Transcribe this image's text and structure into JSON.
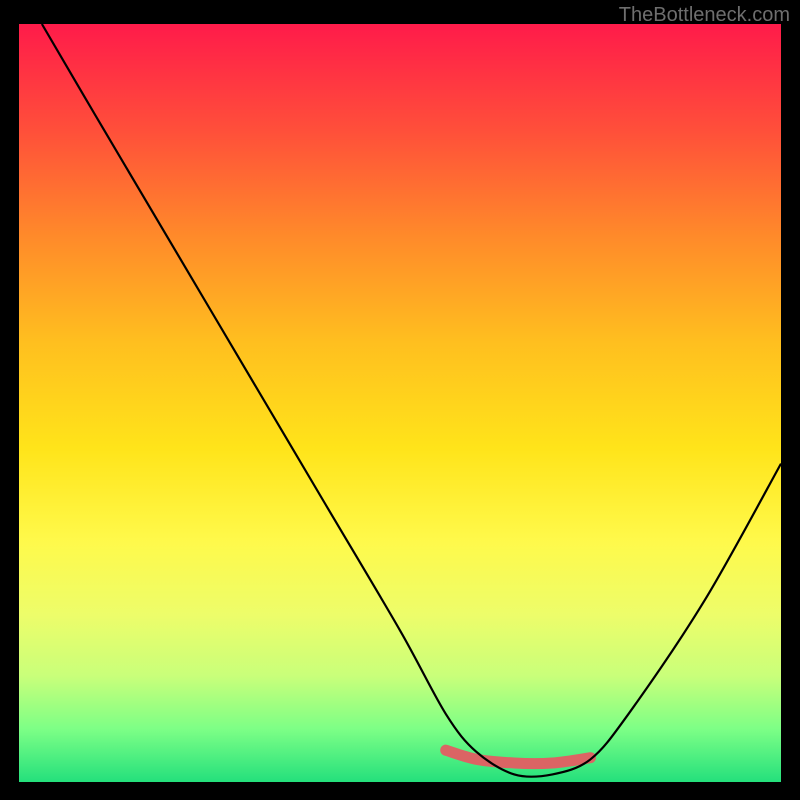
{
  "watermark": "TheBottleneck.com",
  "chart_data": {
    "type": "line",
    "title": "",
    "xlabel": "",
    "ylabel": "",
    "xlim": [
      0,
      100
    ],
    "ylim": [
      0,
      100
    ],
    "series": [
      {
        "name": "bottleneck-curve",
        "x": [
          3,
          10,
          20,
          30,
          40,
          50,
          56,
          60,
          65,
          70,
          75,
          80,
          90,
          100
        ],
        "y": [
          100,
          88,
          71,
          54,
          37,
          20,
          9,
          4,
          1,
          1,
          3,
          9,
          24,
          42
        ],
        "color": "#000000"
      },
      {
        "name": "optimal-segment",
        "x": [
          56,
          60,
          65,
          70,
          75
        ],
        "y": [
          4.2,
          3.0,
          2.5,
          2.5,
          3.2
        ],
        "color": "#db6464"
      }
    ],
    "background_gradient": {
      "top": "#ff1b4a",
      "bottom": "#24e07c"
    }
  }
}
